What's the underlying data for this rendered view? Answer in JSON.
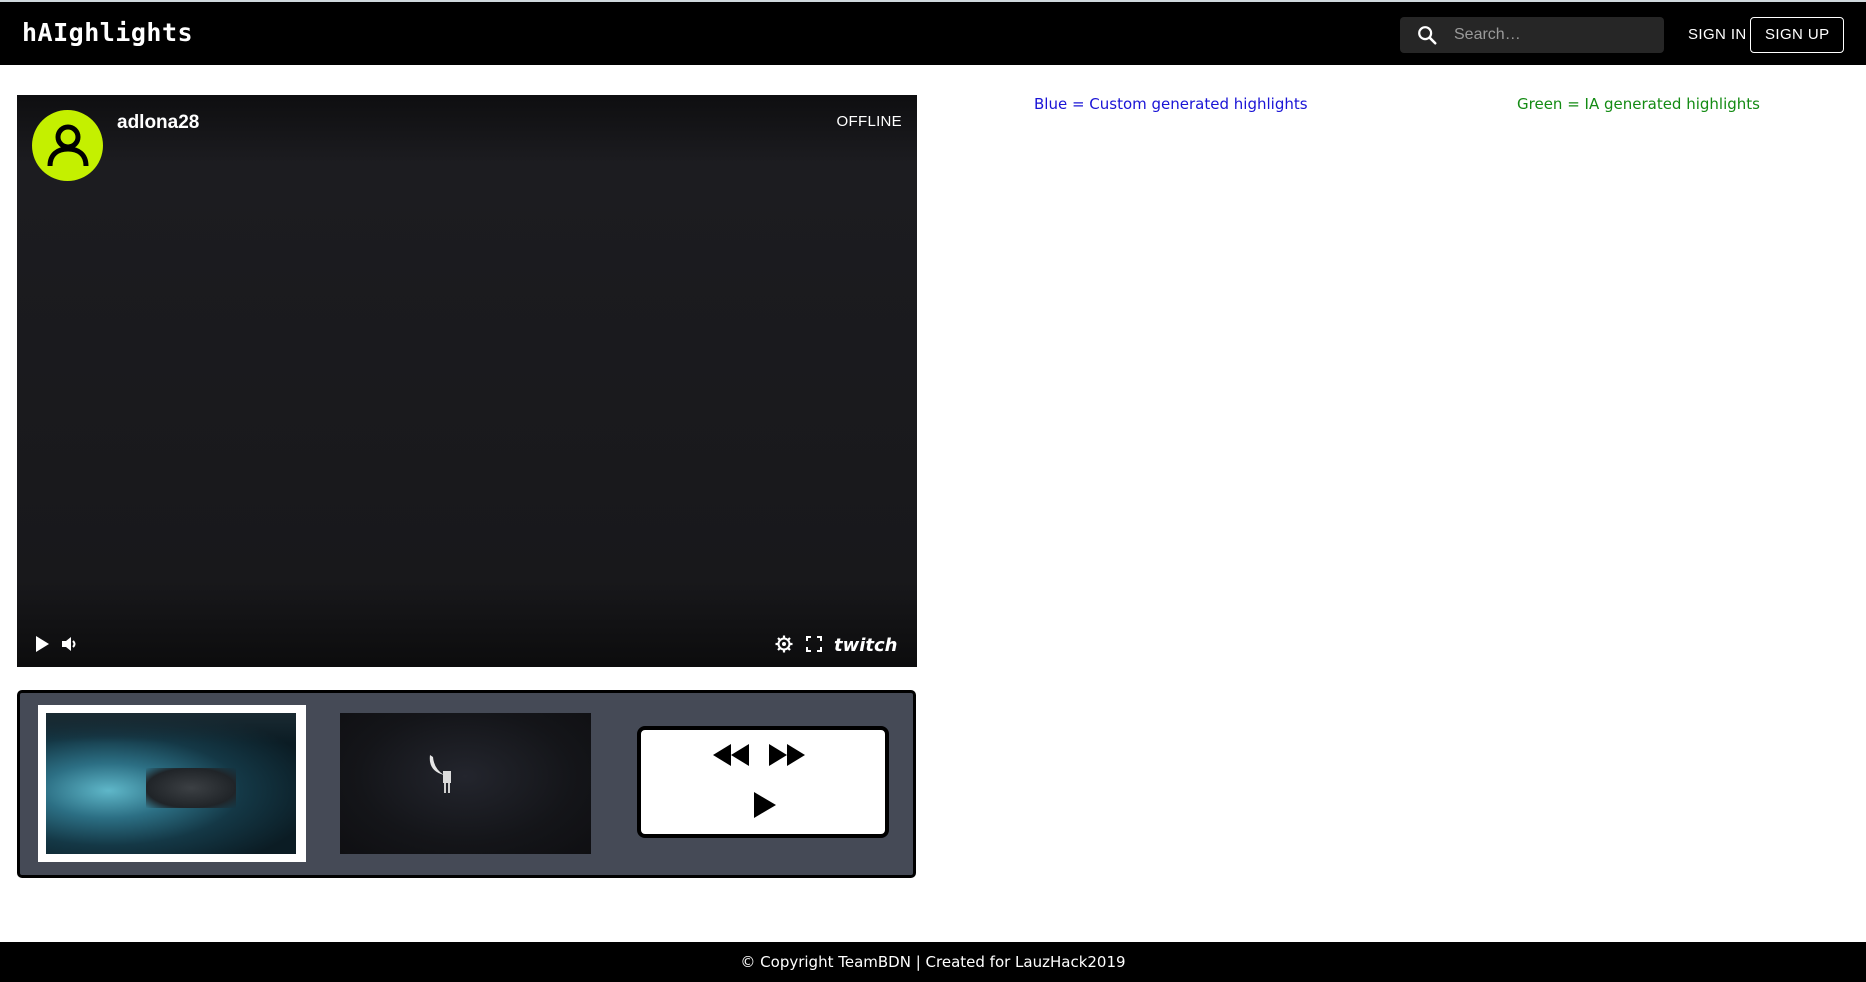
{
  "app": {
    "logo": "hAIghlights",
    "search_placeholder": "Search…",
    "signin_label": "SIGN IN",
    "signup_label": "SIGN UP"
  },
  "player": {
    "channel": "adlona28",
    "status": "OFFLINE",
    "brand": "twitch",
    "avatar_color": "#c4f000",
    "icons": [
      "play-icon",
      "volume-icon",
      "settings-icon",
      "fullscreen-icon",
      "twitch-logo"
    ]
  },
  "highlights": {
    "thumbnails": [
      "highlight-thumbnail-1",
      "highlight-thumbnail-2"
    ],
    "selected": 0,
    "controls": [
      "rewind-icon",
      "fast-forward-icon",
      "play-icon"
    ]
  },
  "legend": {
    "blue": "Blue = Custom generated highlights",
    "green": "Green = IA generated highlights",
    "blue_color": "#1a14d6",
    "green_color": "#138b13"
  },
  "footer": {
    "text": "© Copyright TeamBDN | Created for LauzHack2019"
  }
}
